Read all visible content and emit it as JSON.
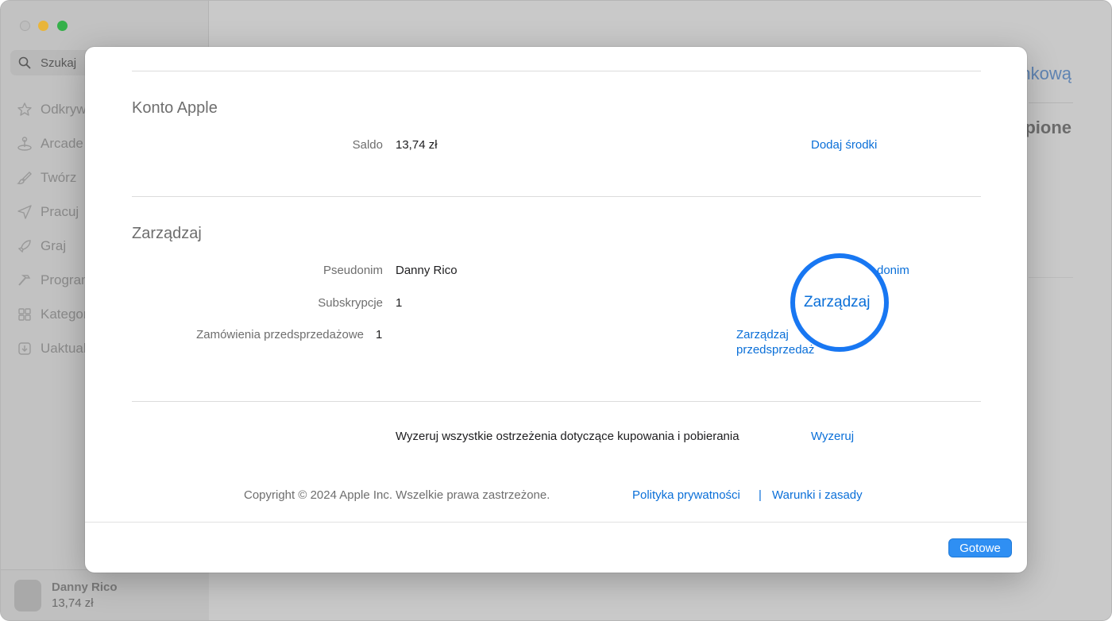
{
  "app": {
    "search_label": "Szukaj",
    "nav_items": [
      {
        "label": "Odkrywaj",
        "icon": "star-icon"
      },
      {
        "label": "Arcade",
        "icon": "joystick-icon"
      },
      {
        "label": "Twórz",
        "icon": "brush-icon"
      },
      {
        "label": "Pracuj",
        "icon": "paper-plane-icon"
      },
      {
        "label": "Graj",
        "icon": "rocket-icon"
      },
      {
        "label": "Programuj",
        "icon": "hammer-icon"
      },
      {
        "label": "Kategorie",
        "icon": "grid-icon"
      },
      {
        "label": "Uaktualnienia",
        "icon": "download-icon"
      }
    ],
    "user": {
      "name": "Danny Rico",
      "balance": "13,74 zł"
    },
    "background_link": "nkową",
    "background_heading": "pione"
  },
  "modal": {
    "account_section": {
      "title": "Konto Apple",
      "balance_label": "Saldo",
      "balance_value": "13,74 zł",
      "add_funds": "Dodaj środki"
    },
    "manage_section": {
      "title": "Zarządzaj",
      "nickname_label": "Pseudonim",
      "nickname_value": "Danny Rico",
      "nickname_link": "donim",
      "subscriptions_label": "Subskrypcje",
      "subscriptions_value": "1",
      "subscriptions_link": "Zarządzaj",
      "preorders_label": "Zamówienia przedsprzedażowe",
      "preorders_value": "1",
      "preorders_link_line1": "Zarządzaj",
      "preorders_link_line2": "przedsprzedaż"
    },
    "reset_section": {
      "text": "Wyzeruj wszystkie ostrzeżenia dotyczące kupowania i pobierania",
      "link": "Wyzeruj"
    },
    "footer": {
      "copyright": "Copyright © 2024 Apple Inc. Wszelkie prawa zastrzeżone.",
      "privacy": "Polityka prywatności",
      "separator": "|",
      "terms": "Warunki i zasady"
    },
    "done_button": "Gotowe"
  },
  "colors": {
    "accent": "#0a6fd8",
    "highlight_ring": "#1877f2",
    "button": "#2f8ff3"
  }
}
